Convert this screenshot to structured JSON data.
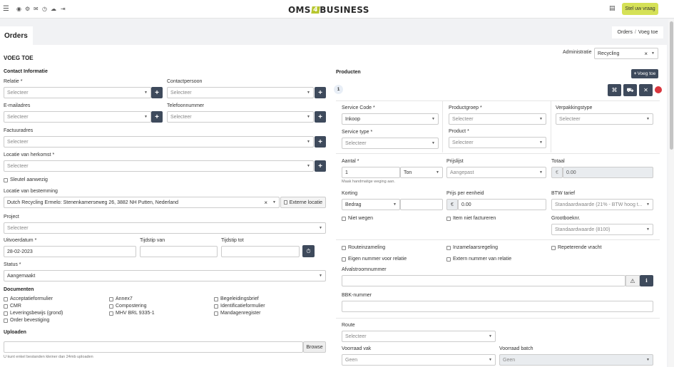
{
  "header": {
    "logo_left": "OMS",
    "logo_mid": "4",
    "logo_right": "BUSINESS",
    "help_button": "Stel uw vraag"
  },
  "page": {
    "title": "Orders",
    "breadcrumb_parent": "Orders",
    "breadcrumb_sep": "/",
    "breadcrumb_current": "Voeg toe",
    "section_title": "VOEG TOE"
  },
  "admin": {
    "label": "Administratie",
    "value": "Recycling",
    "clear": "×"
  },
  "left": {
    "contact_heading": "Contact Informatie",
    "relatie_label": "Relatie *",
    "relatie_ph": "Selecteer",
    "contactpersoon_label": "Contactpersoon",
    "contactpersoon_ph": "Selecteer",
    "email_label": "E-mailadres",
    "email_ph": "Selecteer",
    "telefoon_label": "Telefoonnummer",
    "telefoon_ph": "Selecteer",
    "factuur_label": "Factuuradres",
    "factuur_ph": "Selecteer",
    "herkomst_label": "Locatie van herkomst *",
    "herkomst_ph": "Selecteer",
    "sleutel_label": "Sleutel aanwezig",
    "bestemming_label": "Locatie van bestemming",
    "bestemming_value": "Dutch Recycling Ermelo: Stenenkamerseweg 26, 3882 NH Putten, Nederland",
    "externe_label": "Externe locatie",
    "project_label": "Project",
    "project_ph": "Selecteer",
    "uitvoerdatum_label": "Uitvoerdatum *",
    "uitvoerdatum_value": "28-02-2023",
    "tijd_van_label": "Tijdstip van",
    "tijd_tot_label": "Tijdstip tot",
    "status_label": "Status *",
    "status_value": "Aangemaakt",
    "documenten_heading": "Documenten",
    "docs": [
      "Acceptatieformulier",
      "Annex7",
      "Begeleidingsbrief",
      "CMR",
      "Compostering",
      "Identificatieformulier",
      "Leveringsbewijs (grond)",
      "MHV BRL 9335-1",
      "Mandagenregister",
      "Order bevestiging"
    ],
    "uploaden_heading": "Uploaden",
    "browse": "Browse",
    "upload_hint": "U kunt enkel bestanden kleiner dan 24mb uploaden"
  },
  "right": {
    "producten_heading": "Producten",
    "add_button": "Voeg toe",
    "item_number": "1",
    "service_code_label": "Service Code *",
    "service_code_value": "Inkoop",
    "productgroep_label": "Productgroep *",
    "productgroep_ph": "Selecteer",
    "verpakking_label": "Verpakkingstype",
    "verpakking_ph": "Selecteer",
    "service_type_label": "Service type *",
    "service_type_ph": "Selecteer",
    "product_label": "Product *",
    "product_ph": "Selecteer",
    "aantal_label": "Aantal *",
    "aantal_value": "1",
    "unit_value": "Ton",
    "prijslijst_label": "Prijslijst",
    "prijslijst_value": "Aangepast",
    "totaal_label": "Totaal",
    "currency": "€",
    "totaal_value": "0.00",
    "weging_hint": "Maak handmatige weging aan.",
    "korting_label": "Korting",
    "korting_type": "Bedrag",
    "prijs_label": "Prijs per eenheid",
    "prijs_value": "0.00",
    "btw_label": "BTW tarief",
    "btw_value": "Standaardwaarde (21% - BTW hoog t...",
    "niet_wegen": "Niet wegen",
    "niet_factureren": "Item niet factureren",
    "grootboek_label": "Grootboeknr.",
    "grootboek_value": "Standaardwaarde (8100)",
    "routeinzameling": "Routeinzameling",
    "inzamelaarsregeling": "Inzamelaarsregeling",
    "repeterende": "Repeterende vracht",
    "eigen_nummer": "Eigen nummer voor relatie",
    "extern_nummer": "Extern nummer van relatie",
    "afvalstroom_label": "Afvalstroomnummer",
    "bbk_label": "BBK-nummer",
    "route_label": "Route",
    "route_ph": "Selecteer",
    "voorraad_vak_label": "Voorraad vak",
    "voorraad_vak_value": "Geen",
    "voorraad_batch_label": "Voorraad batch",
    "voorraad_batch_value": "Geen"
  }
}
